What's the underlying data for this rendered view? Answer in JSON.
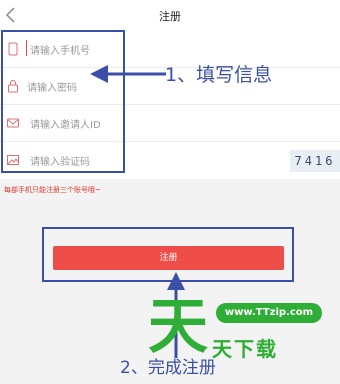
{
  "nav": {
    "title": "注册"
  },
  "form": {
    "phone_placeholder": "请输入手机号",
    "password_placeholder": "请输入密码",
    "invite_placeholder": "请输入邀请人ID",
    "code_placeholder": "请输入验证码",
    "captcha_value": "7416"
  },
  "hint": "每部手机只能注册三个账号哦~",
  "register_button": "注册",
  "annotations": {
    "step1": "1、填写信息",
    "step2": "2、完成注册"
  },
  "watermark": {
    "logo_char": "天",
    "site": "www.TTzip.com",
    "name": "天下载"
  },
  "colors": {
    "accent_red": "#ef4e48",
    "annotation_blue": "#3b4fa8",
    "watermark_green": "#2eae36"
  }
}
